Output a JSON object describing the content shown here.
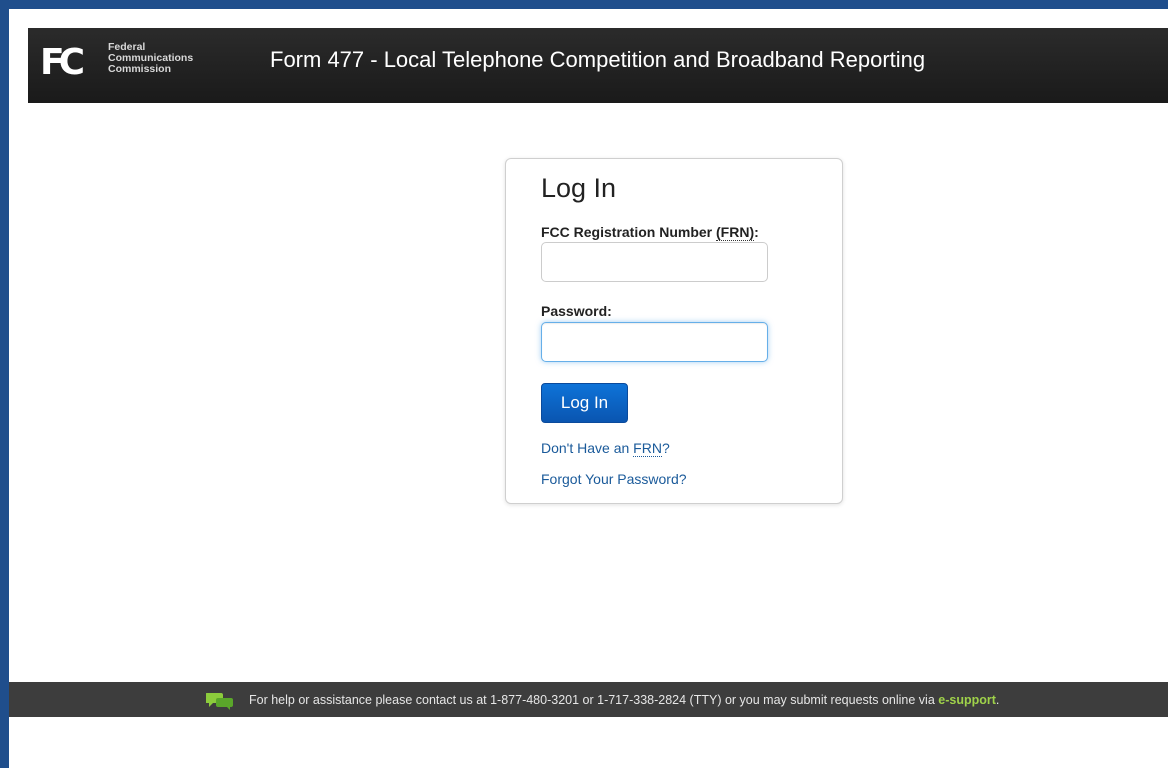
{
  "header": {
    "logo_mark": "FC",
    "logo_lines": [
      "Federal",
      "Communications",
      "Commission"
    ],
    "title": "Form 477 - Local Telephone Competition and Broadband Reporting"
  },
  "login": {
    "heading": "Log In",
    "frn_label": "FCC Registration Number",
    "frn_label_abbr": "(FRN)",
    "frn_label_colon": ":",
    "frn_value": "",
    "password_label": "Password:",
    "password_value": "",
    "button_label": "Log In",
    "no_frn_prefix": "Don't Have an ",
    "no_frn_abbr": "FRN",
    "no_frn_suffix": "?",
    "forgot_password": "Forgot Your Password?"
  },
  "footer": {
    "help_text": "For help or assistance please contact us at 1-877-480-3201 or 1-717-338-2824 (TTY) or you may submit requests online via ",
    "esupport_label": "e-support",
    "trailing": "."
  },
  "colors": {
    "frame": "#1f4e8c",
    "header_bg": "#1a1a1a",
    "button_bg": "#0a55b0",
    "link": "#1a5a9a",
    "footer_bg": "#3d3d3d",
    "footer_link": "#9fd24a"
  }
}
